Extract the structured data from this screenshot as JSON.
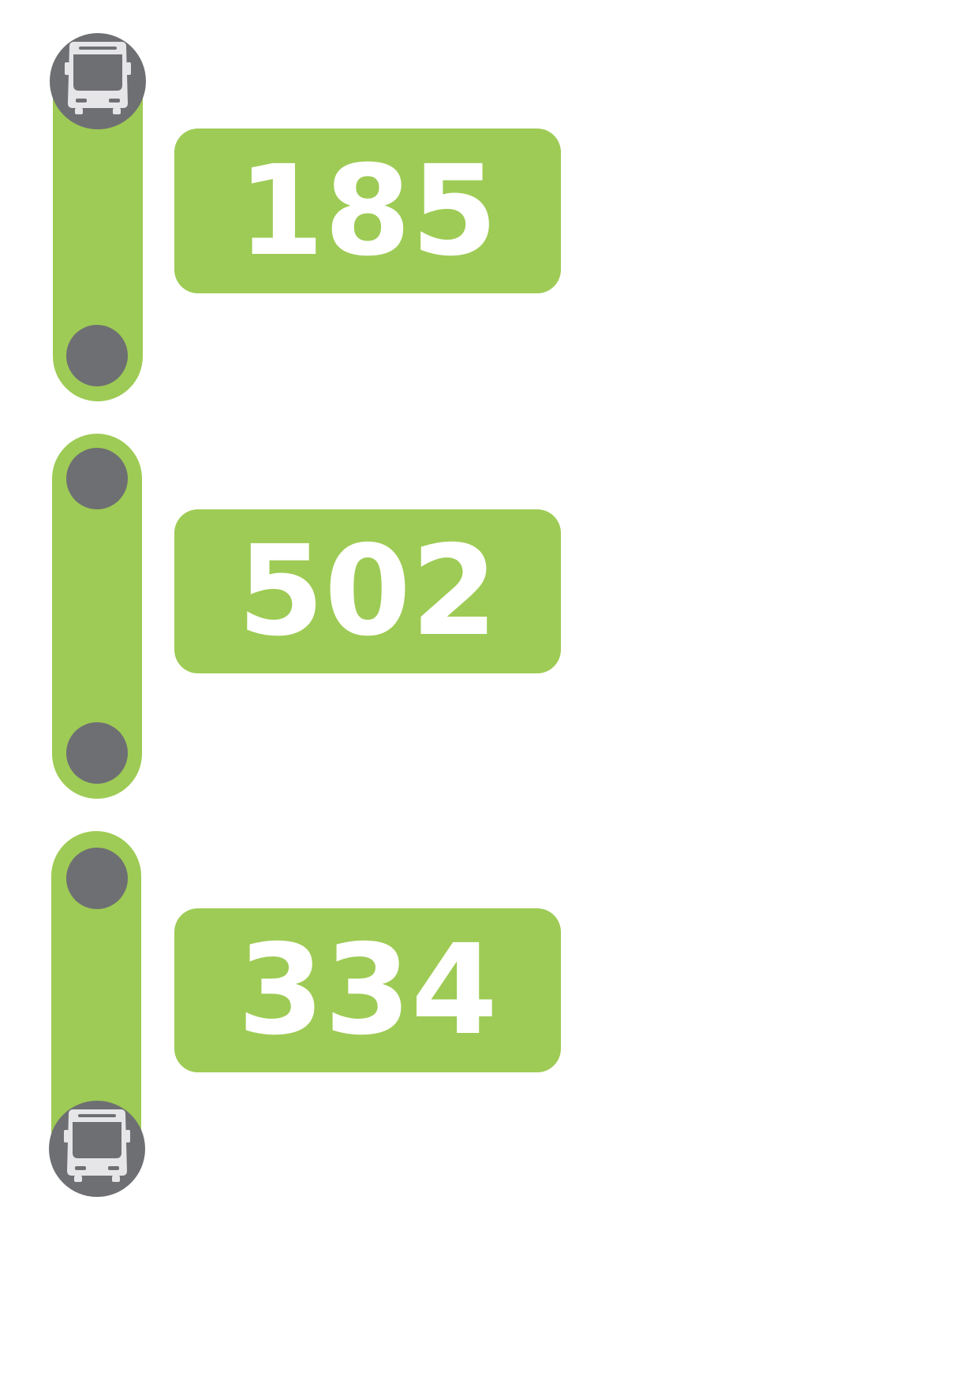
{
  "colors": {
    "route_green": "#9ecb55",
    "stop_gray": "#6e6f73",
    "bus_icon_fill": "#e6e6e8",
    "label_text": "#ffffff",
    "background": "#ffffff"
  },
  "segments": [
    {
      "route_number": "185",
      "start_marker": "bus-icon",
      "end_marker": "stop-dot"
    },
    {
      "route_number": "502",
      "start_marker": "stop-dot",
      "end_marker": "stop-dot"
    },
    {
      "route_number": "334",
      "start_marker": "stop-dot",
      "end_marker": "bus-icon"
    }
  ]
}
